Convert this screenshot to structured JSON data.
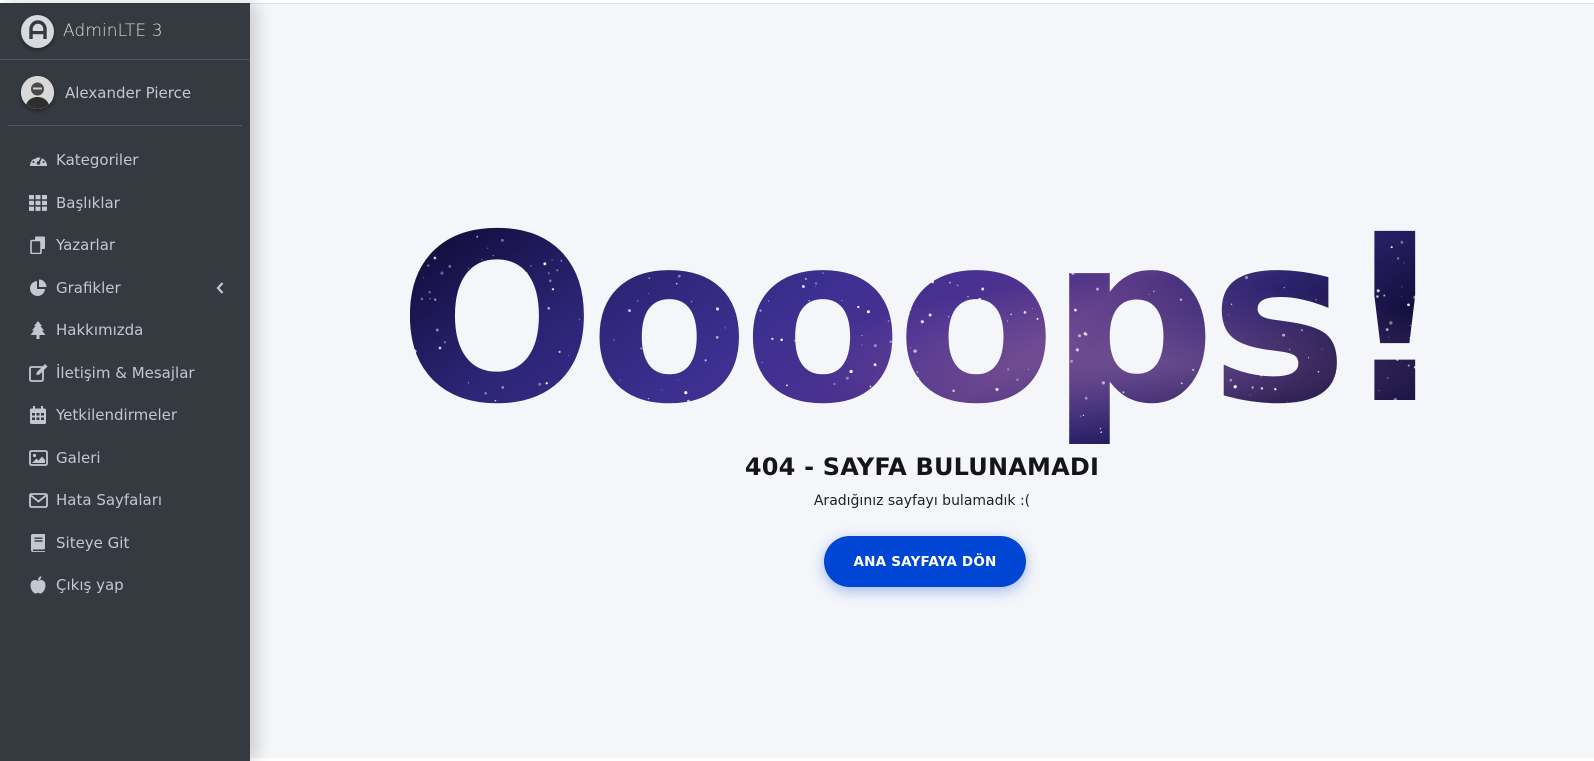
{
  "brand": {
    "title": "AdminLTE 3"
  },
  "user": {
    "name": "Alexander Pierce"
  },
  "sidebar": {
    "items": [
      {
        "label": "Kategoriler",
        "icon": "tachometer-icon"
      },
      {
        "label": "Başlıklar",
        "icon": "th-grid-icon"
      },
      {
        "label": "Yazarlar",
        "icon": "copy-icon"
      },
      {
        "label": "Grafikler",
        "icon": "chart-pie-icon",
        "has_submenu": true
      },
      {
        "label": "Hakkımızda",
        "icon": "tree-icon"
      },
      {
        "label": "İletişim & Mesajlar",
        "icon": "edit-icon"
      },
      {
        "label": "Yetkilendirmeler",
        "icon": "calendar-icon"
      },
      {
        "label": "Galeri",
        "icon": "image-icon"
      },
      {
        "label": "Hata Sayfaları",
        "icon": "envelope-icon"
      },
      {
        "label": "Siteye Git",
        "icon": "book-icon"
      },
      {
        "label": "Çıkış yap",
        "icon": "apple-icon"
      }
    ]
  },
  "error_page": {
    "big_text": "Oooops!",
    "title": "404 - SAYFA BULUNAMADI",
    "subtitle": "Aradığınız sayfayı bulamadık :(",
    "button_label": "ANA SAYFAYA DÖN"
  },
  "colors": {
    "sidebar_bg": "#343a40",
    "sidebar_text": "#c2c7d0",
    "content_bg": "#f4f6f9",
    "accent_button": "#0046d5",
    "galaxy_dark": "#120c3a",
    "galaxy_purple": "#4a2f8f"
  }
}
